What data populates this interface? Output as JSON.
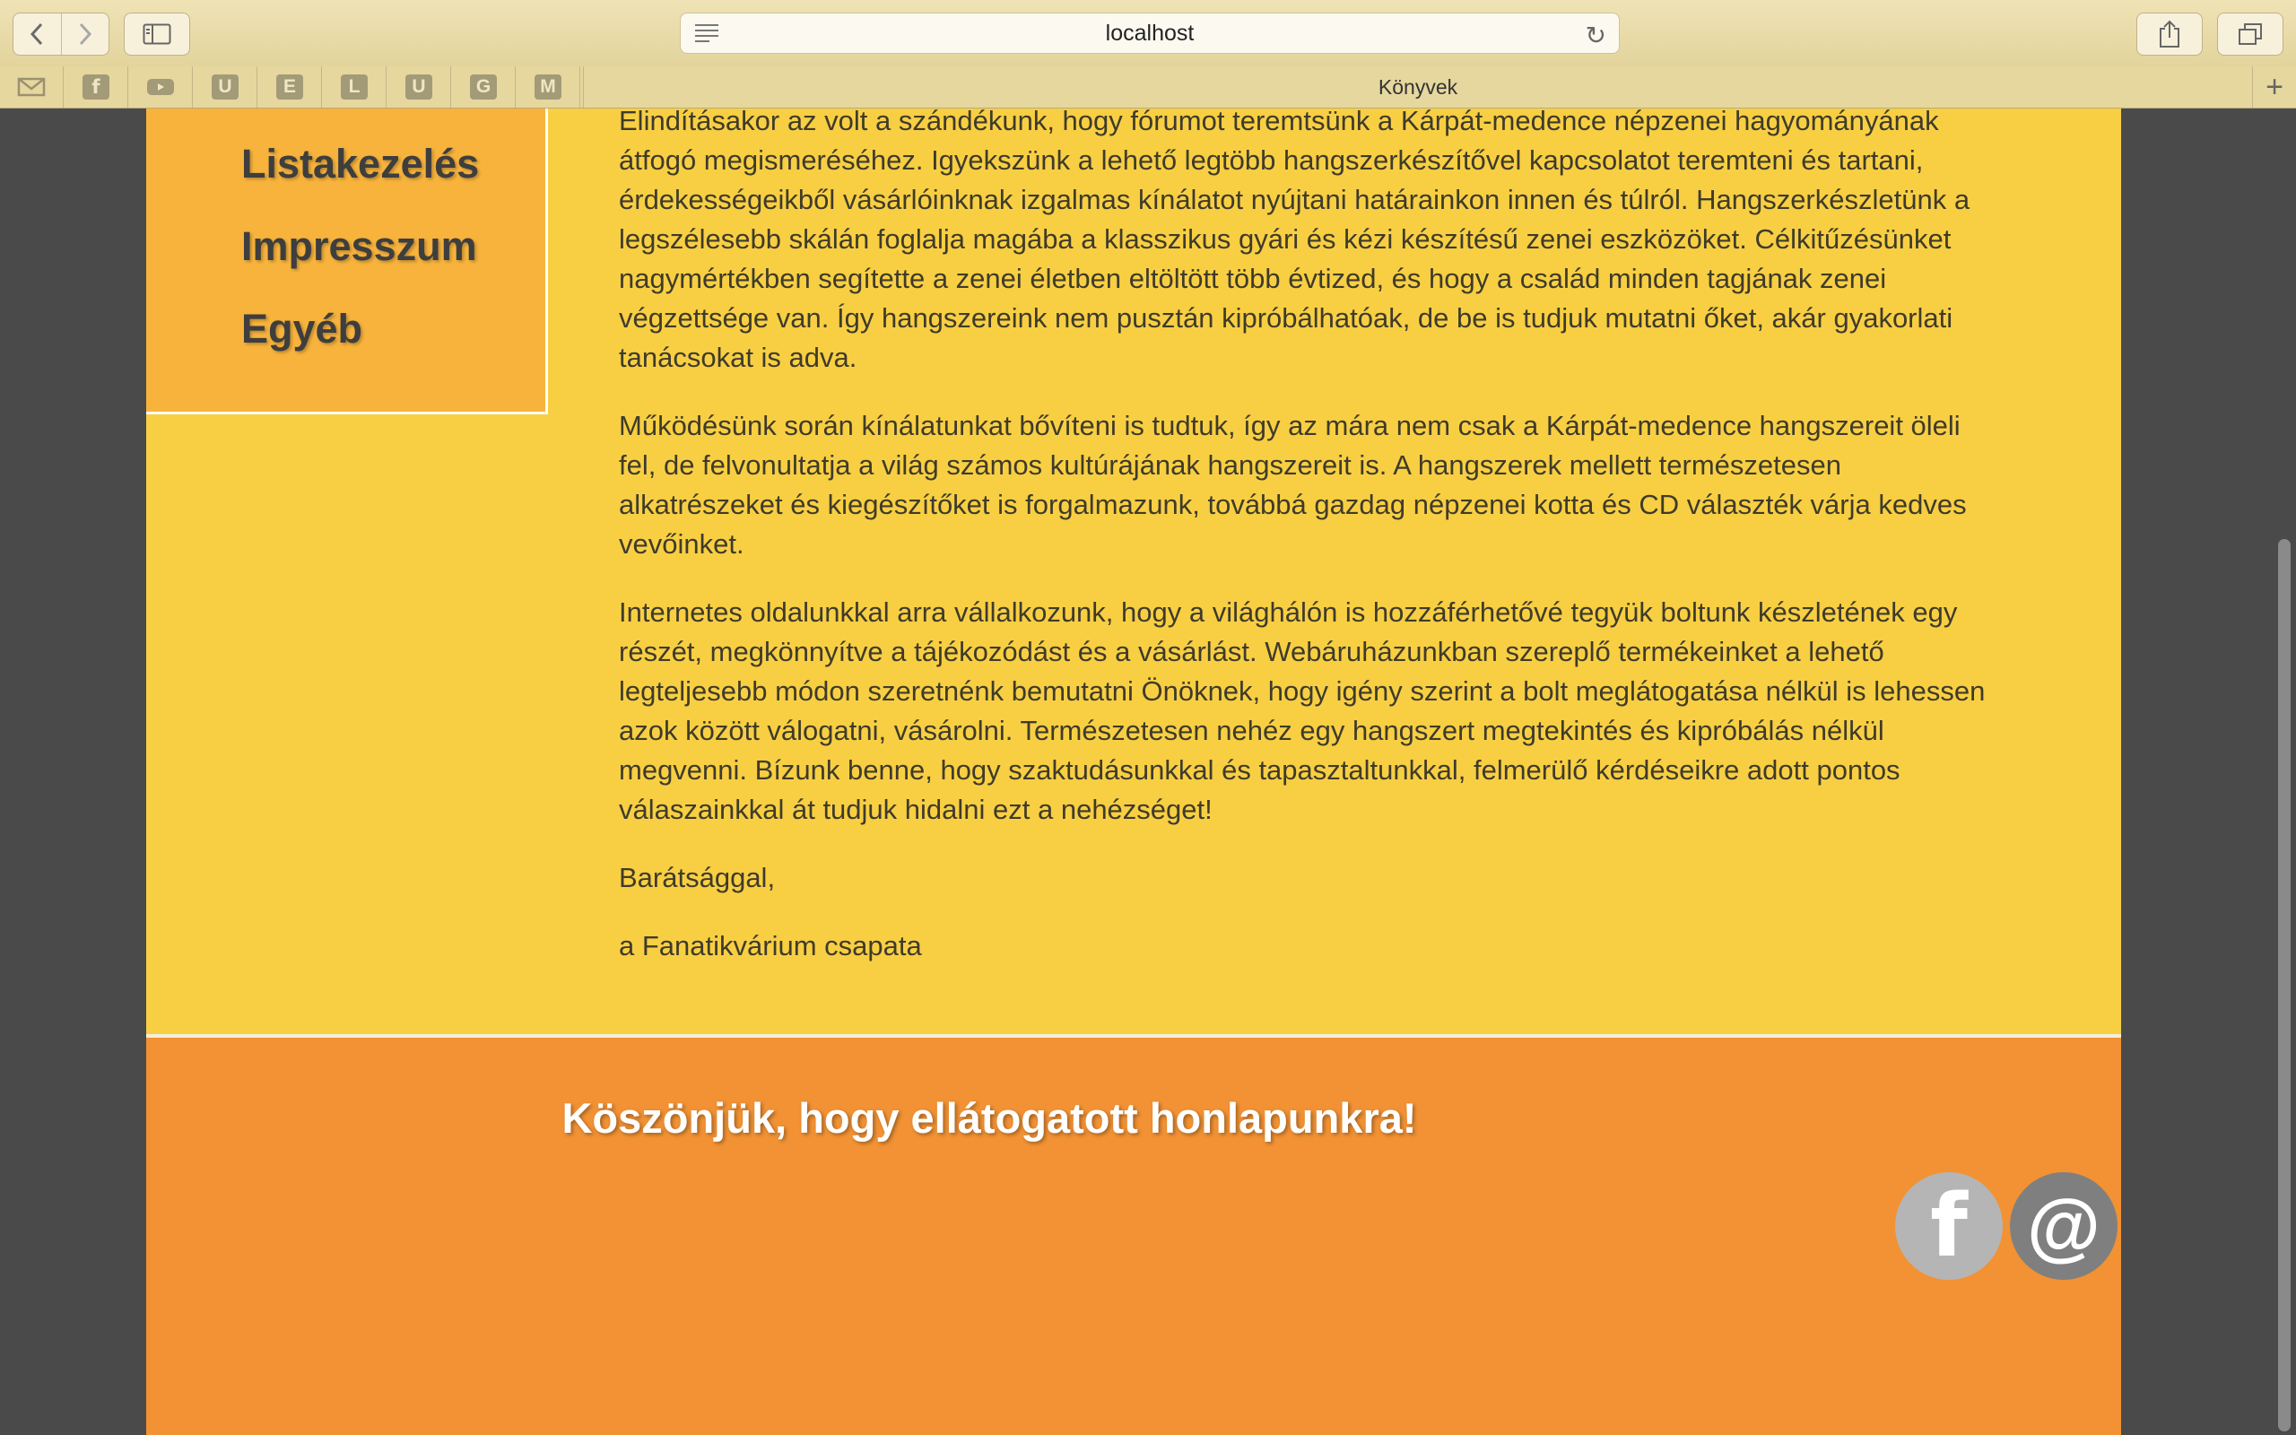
{
  "browser": {
    "url": "localhost",
    "tab_title": "Könyvek",
    "bookmarks": [
      {
        "icon": "mail-icon",
        "label": ""
      },
      {
        "icon": "facebook-icon",
        "label": ""
      },
      {
        "icon": "youtube-icon",
        "label": ""
      },
      {
        "icon": "letter-icon",
        "label": "U"
      },
      {
        "icon": "letter-icon",
        "label": "E"
      },
      {
        "icon": "letter-icon",
        "label": "L"
      },
      {
        "icon": "letter-icon",
        "label": "U"
      },
      {
        "icon": "letter-icon",
        "label": "G"
      },
      {
        "icon": "letter-icon",
        "label": "M"
      }
    ]
  },
  "sidebar": {
    "items": [
      {
        "label": "Listakezelés"
      },
      {
        "label": "Impresszum"
      },
      {
        "label": "Egyéb"
      }
    ]
  },
  "content": {
    "paragraphs": [
      "Elindításakor az volt a szándékunk, hogy fórumot teremtsünk a Kárpát-medence népzenei hagyományának átfogó megismeréséhez. Igyekszünk a lehető legtöbb hangszerkészítővel kapcsolatot teremteni és tartani, érdekességeikből vásárlóinknak izgalmas kínálatot nyújtani határainkon innen és túlról. Hangszerkészletünk a legszélesebb skálán foglalja magába a klasszikus gyári és kézi készítésű zenei eszközöket. Célkitűzésünket nagymértékben segítette a zenei életben eltöltött több évtized, és hogy a család minden tagjának zenei végzettsége van. Így hangszereink nem pusztán kipróbálhatóak, de be is tudjuk mutatni őket, akár gyakorlati tanácsokat is adva.",
      "Működésünk során kínálatunkat bővíteni is tudtuk, így az mára nem csak a Kárpát-medence hangszereit öleli fel, de felvonultatja a világ számos kultúrájának hangszereit is. A hangszerek mellett természetesen alkatrészeket és kiegészítőket is forgalmazunk, továbbá gazdag népzenei kotta és CD választék várja kedves vevőinket.",
      "Internetes oldalunkkal arra vállalkozunk, hogy a világhálón is hozzáférhetővé tegyük boltunk készletének egy részét, megkönnyítve a tájékozódást és a vásárlást. Webáruházunkban szereplő termékeinket a lehető legteljesebb módon szeretnénk bemutatni Önöknek, hogy igény szerint a bolt meglátogatása nélkül is lehessen azok között válogatni, vásárolni. Természetesen nehéz egy hangszert megtekintés és kipróbálás nélkül megvenni. Bízunk benne, hogy szaktudásunkkal és tapasztaltunkkal, felmerülő kérdéseikre adott pontos válaszainkkal át tudjuk hidalni ezt a nehézséget!",
      "Barátsággal,",
      "a Fanatikvárium csapata"
    ]
  },
  "footer": {
    "title": "Köszönjük, hogy ellátogatott honlapunkra!",
    "facebook_glyph": "f",
    "email_glyph": "@"
  },
  "colors": {
    "page_bg": "#f8cf43",
    "sidebar_bg": "#f7b33c",
    "footer_bg": "#f29234",
    "facebook_circle": "#b5b5b5",
    "email_circle": "#7f7f7f"
  }
}
